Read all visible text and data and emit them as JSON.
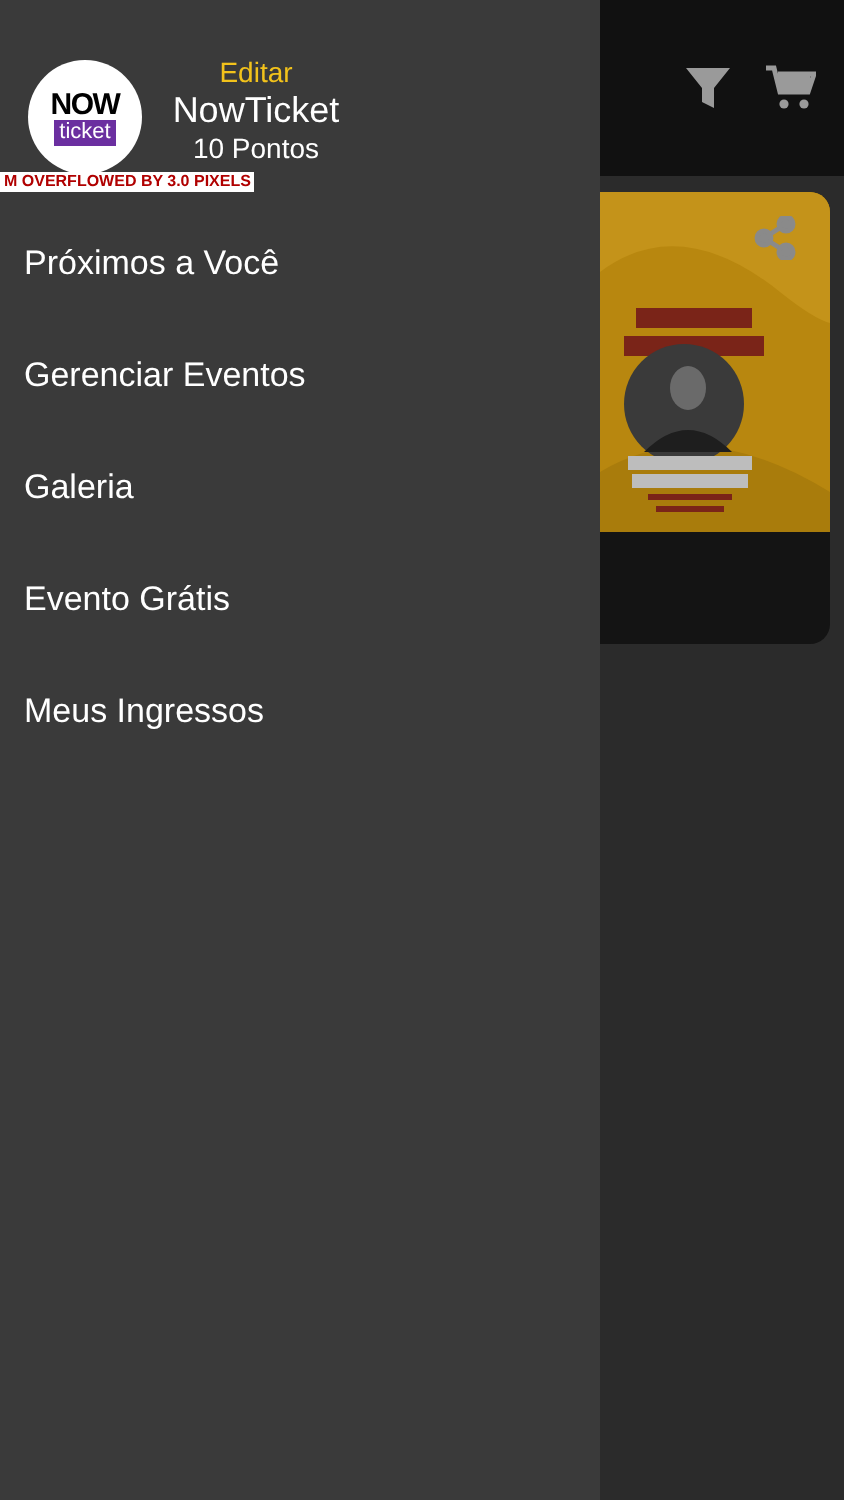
{
  "drawer": {
    "header": {
      "edit_link": "Editar",
      "name": "NowTicket",
      "points": "10 Pontos",
      "logo": {
        "line_1": "NOW",
        "line_2": "ticket"
      },
      "debug_banner": "M OVERFLOWED BY 3.0 PIXELS"
    },
    "items": [
      {
        "label": "Próximos a Você"
      },
      {
        "label": "Gerenciar Eventos"
      },
      {
        "label": "Galeria"
      },
      {
        "label": "Evento Grátis"
      },
      {
        "label": "Meus Ingressos"
      }
    ]
  }
}
